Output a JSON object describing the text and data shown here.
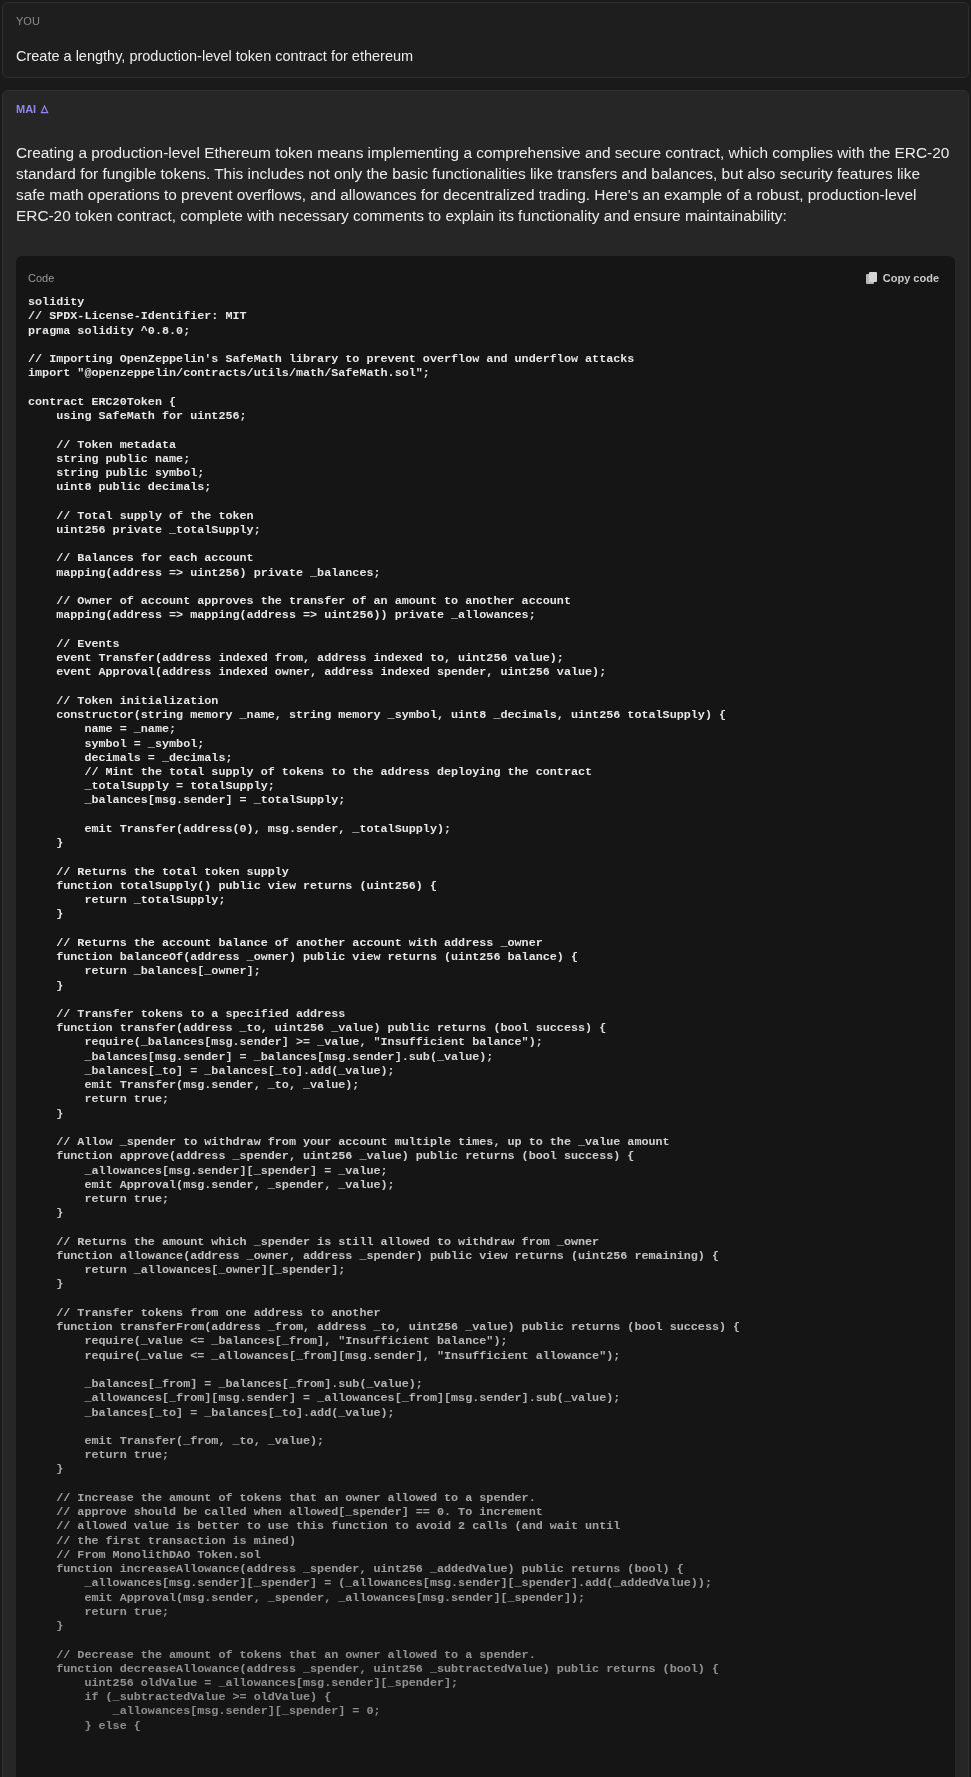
{
  "user_message": {
    "author": "YOU",
    "text": "Create a lengthy, production-level token contract for ethereum"
  },
  "assistant_message": {
    "author": "MAI",
    "text": "Creating a production-level Ethereum token means implementing a comprehensive and secure contract, which complies with the ERC-20 standard for fungible tokens. This includes not only the basic functionalities like transfers and balances, but also security features like safe math operations to prevent overflows, and allowances for decentralized trading. Here's an example of a robust, production-level ERC-20 token contract, complete with necessary comments to explain its functionality and ensure maintainability:",
    "code_block": {
      "label": "Code",
      "copy_button": "Copy code",
      "code": "solidity\n// SPDX-License-Identifier: MIT\npragma solidity ^0.8.0;\n\n// Importing OpenZeppelin's SafeMath library to prevent overflow and underflow attacks\nimport \"@openzeppelin/contracts/utils/math/SafeMath.sol\";\n\ncontract ERC20Token {\n    using SafeMath for uint256;\n\n    // Token metadata\n    string public name;\n    string public symbol;\n    uint8 public decimals;\n\n    // Total supply of the token\n    uint256 private _totalSupply;\n\n    // Balances for each account\n    mapping(address => uint256) private _balances;\n\n    // Owner of account approves the transfer of an amount to another account\n    mapping(address => mapping(address => uint256)) private _allowances;\n\n    // Events\n    event Transfer(address indexed from, address indexed to, uint256 value);\n    event Approval(address indexed owner, address indexed spender, uint256 value);\n\n    // Token initialization\n    constructor(string memory _name, string memory _symbol, uint8 _decimals, uint256 totalSupply) {\n        name = _name;\n        symbol = _symbol;\n        decimals = _decimals;\n        // Mint the total supply of tokens to the address deploying the contract\n        _totalSupply = totalSupply;\n        _balances[msg.sender] = _totalSupply;\n\n        emit Transfer(address(0), msg.sender, _totalSupply);\n    }\n\n    // Returns the total token supply\n    function totalSupply() public view returns (uint256) {\n        return _totalSupply;\n    }\n\n    // Returns the account balance of another account with address _owner\n    function balanceOf(address _owner) public view returns (uint256 balance) {\n        return _balances[_owner];\n    }\n\n    // Transfer tokens to a specified address\n    function transfer(address _to, uint256 _value) public returns (bool success) {\n        require(_balances[msg.sender] >= _value, \"Insufficient balance\");\n        _balances[msg.sender] = _balances[msg.sender].sub(_value);\n        _balances[_to] = _balances[_to].add(_value);\n        emit Transfer(msg.sender, _to, _value);\n        return true;\n    }\n\n    // Allow _spender to withdraw from your account multiple times, up to the _value amount\n    function approve(address _spender, uint256 _value) public returns (bool success) {\n        _allowances[msg.sender][_spender] = _value;\n        emit Approval(msg.sender, _spender, _value);\n        return true;\n    }\n\n    // Returns the amount which _spender is still allowed to withdraw from _owner\n    function allowance(address _owner, address _spender) public view returns (uint256 remaining) {\n        return _allowances[_owner][_spender];\n    }\n\n    // Transfer tokens from one address to another\n    function transferFrom(address _from, address _to, uint256 _value) public returns (bool success) {\n        require(_value <= _balances[_from], \"Insufficient balance\");\n        require(_value <= _allowances[_from][msg.sender], \"Insufficient allowance\");\n\n        _balances[_from] = _balances[_from].sub(_value);\n        _allowances[_from][msg.sender] = _allowances[_from][msg.sender].sub(_value);\n        _balances[_to] = _balances[_to].add(_value);\n\n        emit Transfer(_from, _to, _value);\n        return true;\n    }\n\n    // Increase the amount of tokens that an owner allowed to a spender.\n    // approve should be called when allowed[_spender] == 0. To increment\n    // allowed value is better to use this function to avoid 2 calls (and wait until\n    // the first transaction is mined)\n    // From MonolithDAO Token.sol\n    function increaseAllowance(address _spender, uint256 _addedValue) public returns (bool) {\n        _allowances[msg.sender][_spender] = (_allowances[msg.sender][_spender].add(_addedValue));\n        emit Approval(msg.sender, _spender, _allowances[msg.sender][_spender]);\n        return true;\n    }\n\n    // Decrease the amount of tokens that an owner allowed to a spender.\n    function decreaseAllowance(address _spender, uint256 _subtractedValue) public returns (bool) {\n        uint256 oldValue = _allowances[msg.sender][_spender];\n        if (_subtractedValue >= oldValue) {\n            _allowances[msg.sender][_spender] = 0;\n        } else {"
    }
  }
}
